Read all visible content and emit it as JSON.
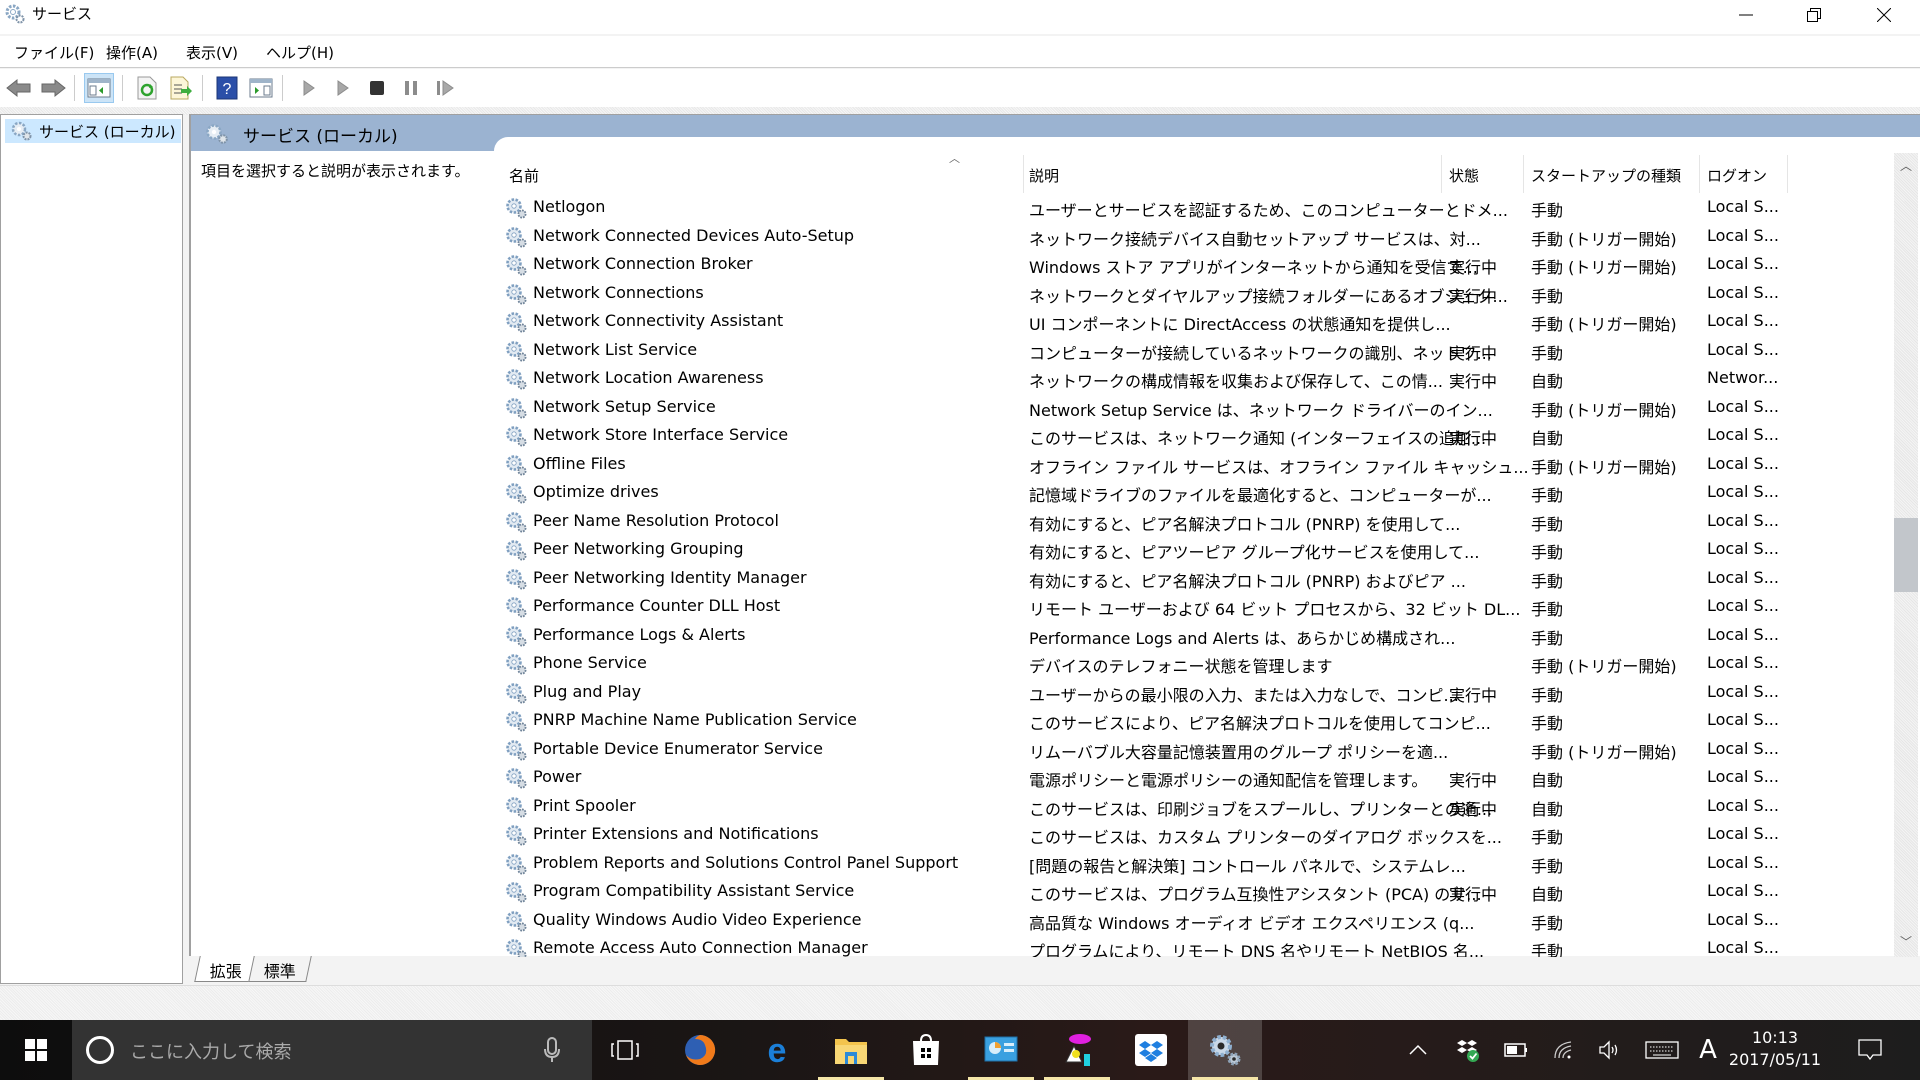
{
  "window": {
    "title": "サービス",
    "controls": {
      "minimize": "minimize",
      "restore": "restore",
      "close": "close"
    }
  },
  "menu": [
    "ファイル(F)",
    "操作(A)",
    "表示(V)",
    "ヘルプ(H)"
  ],
  "toolbar": {
    "buttons": [
      {
        "icon": "back-arrow-icon"
      },
      {
        "icon": "forward-arrow-icon"
      },
      {
        "icon": "show-hide-console-tree-icon",
        "active": true
      },
      {
        "icon": "refresh-icon"
      },
      {
        "icon": "export-list-icon"
      },
      {
        "icon": "help-icon"
      },
      {
        "icon": "show-hide-action-pane-icon"
      },
      {
        "icon": "start-service-icon"
      },
      {
        "icon": "start-service-alt-icon"
      },
      {
        "icon": "stop-service-icon"
      },
      {
        "icon": "pause-service-icon"
      },
      {
        "icon": "resume-service-icon"
      }
    ]
  },
  "tree": {
    "selected_item": "サービス (ローカル)"
  },
  "panel": {
    "title": "サービス (ローカル)",
    "description_hint": "項目を選択すると説明が表示されます。"
  },
  "columns": {
    "name": "名前",
    "description": "説明",
    "status": "状態",
    "startup": "スタートアップの種類",
    "logon": "ログオン"
  },
  "services": [
    {
      "name": "Netlogon",
      "description": "ユーザーとサービスを認証するため、このコンピューターとドメ...",
      "status": "",
      "startup": "手動",
      "logon": "Local S..."
    },
    {
      "name": "Network Connected Devices Auto-Setup",
      "description": "ネットワーク接続デバイス自動セットアップ サービスは、対...",
      "status": "",
      "startup": "手動 (トリガー開始)",
      "logon": "Local S..."
    },
    {
      "name": "Network Connection Broker",
      "description": "Windows ストア アプリがインターネットから通知を受信で...",
      "status": "実行中",
      "startup": "手動 (トリガー開始)",
      "logon": "Local S..."
    },
    {
      "name": "Network Connections",
      "description": "ネットワークとダイヤルアップ接続フォルダーにあるオブジェク...",
      "status": "実行中",
      "startup": "手動",
      "logon": "Local S..."
    },
    {
      "name": "Network Connectivity Assistant",
      "description": "UI コンポーネントに DirectAccess の状態通知を提供し...",
      "status": "",
      "startup": "手動 (トリガー開始)",
      "logon": "Local S..."
    },
    {
      "name": "Network List Service",
      "description": "コンピューターが接続しているネットワークの識別、ネットワ...",
      "status": "実行中",
      "startup": "手動",
      "logon": "Local S..."
    },
    {
      "name": "Network Location Awareness",
      "description": "ネットワークの構成情報を収集および保存して、この情...",
      "status": "実行中",
      "startup": "自動",
      "logon": "Networ..."
    },
    {
      "name": "Network Setup Service",
      "description": "Network Setup Service は、ネットワーク ドライバーのイン...",
      "status": "",
      "startup": "手動 (トリガー開始)",
      "logon": "Local S..."
    },
    {
      "name": "Network Store Interface Service",
      "description": "このサービスは、ネットワーク通知 (インターフェイスの追加...",
      "status": "実行中",
      "startup": "自動",
      "logon": "Local S..."
    },
    {
      "name": "Offline Files",
      "description": "オフライン ファイル サービスは、オフライン ファイル キャッシュ...",
      "status": "",
      "startup": "手動 (トリガー開始)",
      "logon": "Local S..."
    },
    {
      "name": "Optimize drives",
      "description": "記憶域ドライブのファイルを最適化すると、コンピューターが...",
      "status": "",
      "startup": "手動",
      "logon": "Local S..."
    },
    {
      "name": "Peer Name Resolution Protocol",
      "description": "有効にすると、ピア名解決プロトコル (PNRP) を使用して...",
      "status": "",
      "startup": "手動",
      "logon": "Local S..."
    },
    {
      "name": "Peer Networking Grouping",
      "description": "有効にすると、ピアツーピア グループ化サービスを使用して...",
      "status": "",
      "startup": "手動",
      "logon": "Local S..."
    },
    {
      "name": "Peer Networking Identity Manager",
      "description": "有効にすると、ピア名解決プロトコル (PNRP) およびピア ...",
      "status": "",
      "startup": "手動",
      "logon": "Local S..."
    },
    {
      "name": "Performance Counter DLL Host",
      "description": "リモート ユーザーおよび 64 ビット プロセスから、32 ビット DL...",
      "status": "",
      "startup": "手動",
      "logon": "Local S..."
    },
    {
      "name": "Performance Logs & Alerts",
      "description": "Performance Logs and Alerts は、あらかじめ構成され...",
      "status": "",
      "startup": "手動",
      "logon": "Local S..."
    },
    {
      "name": "Phone Service",
      "description": "デバイスのテレフォニー状態を管理します",
      "status": "",
      "startup": "手動 (トリガー開始)",
      "logon": "Local S..."
    },
    {
      "name": "Plug and Play",
      "description": "ユーザーからの最小限の入力、または入力なしで、コンピ...",
      "status": "実行中",
      "startup": "手動",
      "logon": "Local S..."
    },
    {
      "name": "PNRP Machine Name Publication Service",
      "description": "このサービスにより、ピア名解決プロトコルを使用してコンピ...",
      "status": "",
      "startup": "手動",
      "logon": "Local S..."
    },
    {
      "name": "Portable Device Enumerator Service",
      "description": "リムーバブル大容量記憶装置用のグループ ポリシーを適...",
      "status": "",
      "startup": "手動 (トリガー開始)",
      "logon": "Local S..."
    },
    {
      "name": "Power",
      "description": "電源ポリシーと電源ポリシーの通知配信を管理します。",
      "status": "実行中",
      "startup": "自動",
      "logon": "Local S..."
    },
    {
      "name": "Print Spooler",
      "description": "このサービスは、印刷ジョブをスプールし、プリンターとの通...",
      "status": "実行中",
      "startup": "自動",
      "logon": "Local S..."
    },
    {
      "name": "Printer Extensions and Notifications",
      "description": "このサービスは、カスタム プリンターのダイアログ ボックスを...",
      "status": "",
      "startup": "手動",
      "logon": "Local S..."
    },
    {
      "name": "Problem Reports and Solutions Control Panel Support",
      "description": "[問題の報告と解決策] コントロール パネルで、システムレ...",
      "status": "",
      "startup": "手動",
      "logon": "Local S..."
    },
    {
      "name": "Program Compatibility Assistant Service",
      "description": "このサービスは、プログラム互換性アシスタント (PCA) のサ...",
      "status": "実行中",
      "startup": "自動",
      "logon": "Local S..."
    },
    {
      "name": "Quality Windows Audio Video Experience",
      "description": "高品質な Windows オーディオ ビデオ エクスペリエンス (q...",
      "status": "",
      "startup": "手動",
      "logon": "Local S..."
    },
    {
      "name": "Remote Access Auto Connection Manager",
      "description": "プログラムにより、リモート DNS 名やリモート NetBIOS 名...",
      "status": "",
      "startup": "手動",
      "logon": "Local S..."
    }
  ],
  "scrollbar": {
    "position_fraction": 0.5,
    "visible_fraction": 0.1
  },
  "tabs": [
    {
      "label": "拡張",
      "active": true
    },
    {
      "label": "標準",
      "active": false
    }
  ],
  "taskbar": {
    "search_placeholder": "ここに入力して検索",
    "apps": [
      "firefox",
      "edge",
      "file-explorer",
      "store",
      "control-panel",
      "paint-app",
      "dropbox",
      "services"
    ],
    "clock_time": "10:13",
    "clock_date": "2017/05/11",
    "ime_indicator": "A"
  },
  "colors": {
    "panel_band": "#9bb3d1",
    "tree_selection": "#cce8ff",
    "taskbar_search": "#333333"
  }
}
